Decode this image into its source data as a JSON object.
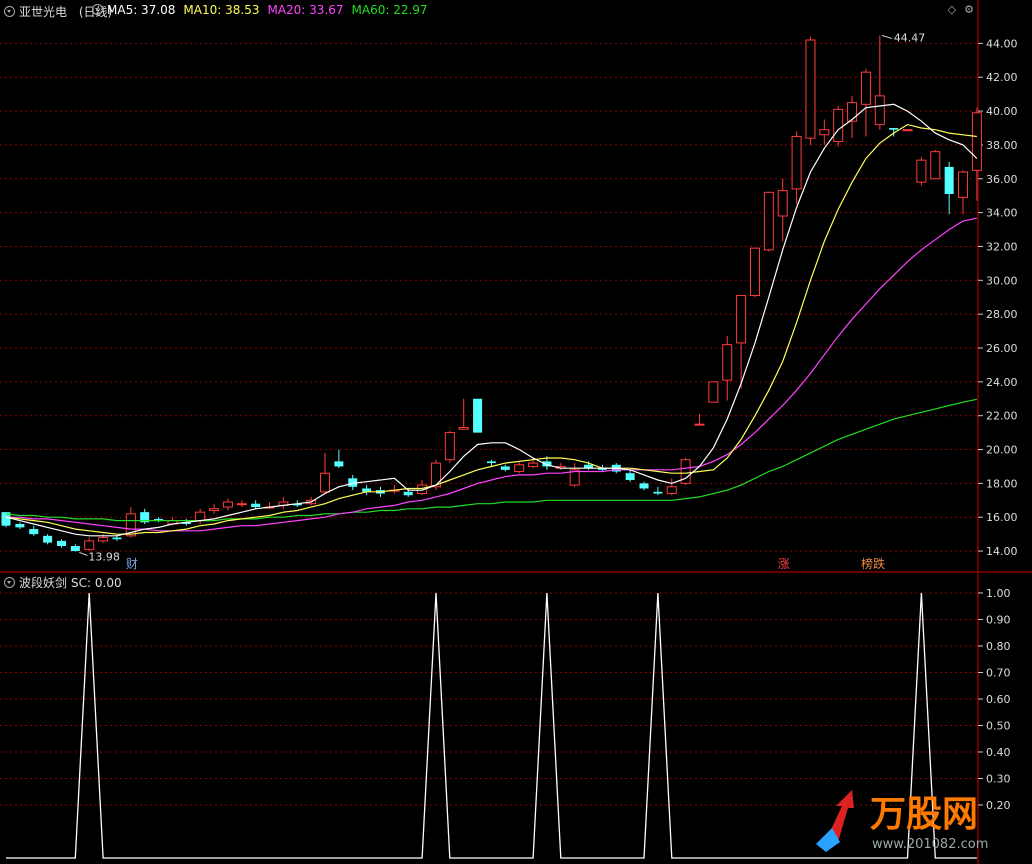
{
  "header": {
    "stock_name": "亚世光电",
    "period": "(日线)",
    "ma5": "MA5: 37.08",
    "ma10": "MA10: 38.53",
    "ma20": "MA20: 33.67",
    "ma60": "MA60: 22.97"
  },
  "indicator_header": {
    "name": "波段妖剑",
    "value": "SC: 0.00"
  },
  "top_icons": {
    "diamond": "◇",
    "settings": "⚙"
  },
  "watermark": {
    "text": "万股网",
    "url": "www.201082.com"
  },
  "colors": {
    "up": "#ff3b3b",
    "down": "#54ffff",
    "ma5": "#ffffff",
    "ma10": "#ffff55",
    "ma20": "#ff44ff",
    "ma60": "#22dd22",
    "grid": "#8a0000",
    "axis": "#ffffff"
  },
  "chart_data": [
    {
      "type": "candlestick",
      "title": "亚世光电 (日线)",
      "y_ticks": [
        14,
        16,
        18,
        20,
        22,
        24,
        26,
        28,
        30,
        32,
        34,
        36,
        38,
        40,
        42,
        44
      ],
      "y_tick_labels": [
        "14.00",
        "16.00",
        "18.00",
        "20.00",
        "22.00",
        "24.00",
        "26.00",
        "28.00",
        "30.00",
        "32.00",
        "34.00",
        "36.00",
        "38.00",
        "40.00",
        "42.00",
        "44.00"
      ],
      "ylim": [
        13.0,
        45.5
      ],
      "annotations": {
        "low": "13.98",
        "high": "44.47",
        "event1": "财",
        "event2": "涨",
        "event3": "榜跌"
      },
      "candles": [
        [
          16.3,
          15.5,
          16.3,
          15.4
        ],
        [
          15.6,
          15.4,
          15.7,
          15.3
        ],
        [
          15.3,
          15.0,
          15.5,
          14.9
        ],
        [
          14.9,
          14.5,
          15.0,
          14.4
        ],
        [
          14.6,
          14.3,
          14.7,
          14.2
        ],
        [
          14.3,
          14.0,
          14.4,
          13.98
        ],
        [
          14.1,
          14.6,
          14.8,
          14.0
        ],
        [
          14.6,
          14.8,
          15.0,
          14.5
        ],
        [
          14.8,
          14.7,
          14.9,
          14.6
        ],
        [
          14.9,
          16.2,
          16.6,
          14.8
        ],
        [
          16.3,
          15.7,
          16.5,
          15.6
        ],
        [
          15.9,
          15.8,
          16.0,
          15.7
        ],
        [
          15.6,
          15.8,
          16.0,
          15.5
        ],
        [
          15.7,
          15.6,
          15.9,
          15.5
        ],
        [
          15.8,
          16.3,
          16.5,
          15.6
        ],
        [
          16.4,
          16.5,
          16.8,
          16.2
        ],
        [
          16.6,
          16.9,
          17.1,
          16.4
        ],
        [
          16.8,
          16.8,
          17.0,
          16.6
        ],
        [
          16.8,
          16.6,
          17.0,
          16.5
        ],
        [
          16.6,
          16.6,
          16.9,
          16.5
        ],
        [
          16.7,
          16.9,
          17.2,
          16.5
        ],
        [
          16.8,
          16.7,
          17.0,
          16.6
        ],
        [
          16.8,
          17.0,
          17.2,
          16.7
        ],
        [
          17.5,
          18.6,
          19.8,
          17.4
        ],
        [
          19.3,
          19.0,
          20.0,
          18.9
        ],
        [
          18.3,
          17.8,
          18.5,
          17.6
        ],
        [
          17.7,
          17.5,
          17.9,
          17.3
        ],
        [
          17.6,
          17.4,
          17.8,
          17.2
        ],
        [
          17.6,
          17.6,
          17.9,
          17.4
        ],
        [
          17.5,
          17.3,
          17.7,
          17.2
        ],
        [
          17.4,
          17.9,
          18.2,
          17.3
        ],
        [
          17.8,
          19.2,
          19.4,
          17.6
        ],
        [
          19.4,
          21.0,
          21.1,
          19.2
        ],
        [
          21.2,
          21.3,
          23.0,
          21.2
        ],
        [
          23.0,
          21.0,
          23.0,
          21.0
        ],
        [
          19.3,
          19.2,
          19.4,
          19.0
        ],
        [
          19.0,
          18.8,
          19.1,
          18.7
        ],
        [
          18.7,
          19.1,
          19.3,
          18.6
        ],
        [
          19.0,
          19.2,
          19.5,
          18.9
        ],
        [
          19.3,
          19.0,
          19.6,
          18.8
        ],
        [
          18.9,
          19.0,
          19.2,
          18.8
        ],
        [
          17.9,
          18.8,
          19.2,
          17.8
        ],
        [
          19.1,
          18.9,
          19.3,
          18.8
        ],
        [
          18.9,
          18.8,
          19.1,
          18.7
        ],
        [
          19.1,
          18.7,
          19.2,
          18.6
        ],
        [
          18.6,
          18.2,
          18.8,
          18.1
        ],
        [
          18.0,
          17.7,
          18.1,
          17.6
        ],
        [
          17.5,
          17.4,
          17.8,
          17.3
        ],
        [
          17.4,
          17.8,
          18.3,
          17.3
        ],
        [
          18.0,
          19.4,
          19.5,
          17.9
        ],
        [
          21.5,
          21.5,
          22.1,
          21.5
        ],
        [
          22.8,
          24.0,
          24.0,
          22.8
        ],
        [
          24.1,
          26.2,
          26.7,
          22.9
        ],
        [
          26.3,
          29.1,
          29.1,
          23.6
        ],
        [
          29.1,
          31.9,
          31.9,
          29.0
        ],
        [
          31.8,
          35.2,
          35.2,
          31.7
        ],
        [
          33.8,
          35.3,
          36.0,
          32.3
        ],
        [
          35.4,
          38.5,
          38.8,
          34.5
        ],
        [
          38.4,
          44.2,
          44.4,
          38.0
        ],
        [
          38.6,
          38.9,
          39.5,
          38.0
        ],
        [
          38.2,
          40.1,
          40.3,
          37.9
        ],
        [
          39.4,
          40.5,
          40.9,
          38.4
        ],
        [
          40.4,
          42.3,
          42.5,
          38.5
        ],
        [
          39.2,
          40.9,
          44.47,
          38.9
        ],
        [
          39.0,
          38.9,
          39.0,
          38.5
        ],
        [
          38.9,
          38.9,
          38.9,
          38.9
        ],
        [
          35.8,
          37.1,
          37.3,
          35.6
        ],
        [
          36.0,
          37.6,
          37.7,
          36.0
        ],
        [
          36.7,
          35.1,
          37.0,
          33.9
        ],
        [
          34.9,
          36.4,
          36.5,
          33.9
        ],
        [
          36.5,
          39.9,
          40.2,
          34.7
        ]
      ],
      "ma5": [
        16.0,
        15.8,
        15.6,
        15.4,
        15.2,
        15.0,
        14.9,
        14.9,
        14.9,
        15.1,
        15.3,
        15.4,
        15.6,
        15.7,
        15.8,
        15.9,
        16.1,
        16.3,
        16.5,
        16.6,
        16.7,
        16.8,
        16.9,
        17.4,
        17.8,
        18.0,
        18.1,
        18.2,
        18.3,
        17.6,
        17.6,
        17.9,
        18.7,
        19.6,
        20.3,
        20.4,
        20.4,
        20.0,
        19.5,
        19.1,
        18.9,
        18.9,
        18.9,
        18.9,
        18.9,
        18.8,
        18.5,
        18.2,
        18.0,
        18.3,
        19.0,
        20.1,
        21.8,
        23.9,
        26.3,
        29.0,
        31.8,
        34.3,
        36.4,
        37.8,
        38.9,
        39.5,
        40.2,
        40.3,
        40.4,
        40.0,
        39.4,
        38.7,
        38.3,
        38.0,
        37.2
      ],
      "ma10": [
        16.0,
        15.9,
        15.8,
        15.7,
        15.5,
        15.3,
        15.2,
        15.1,
        15.0,
        15.0,
        15.1,
        15.1,
        15.2,
        15.3,
        15.5,
        15.6,
        15.8,
        15.9,
        16.0,
        16.1,
        16.3,
        16.4,
        16.6,
        16.8,
        17.1,
        17.3,
        17.5,
        17.5,
        17.6,
        17.7,
        17.7,
        17.9,
        18.2,
        18.5,
        18.8,
        19.0,
        19.2,
        19.3,
        19.4,
        19.5,
        19.5,
        19.4,
        19.2,
        18.9,
        18.9,
        18.9,
        18.8,
        18.7,
        18.6,
        18.6,
        18.7,
        18.8,
        19.5,
        20.6,
        22.0,
        23.5,
        25.2,
        27.5,
        30.0,
        32.3,
        34.2,
        35.8,
        37.2,
        38.1,
        38.7,
        39.2,
        39.0,
        38.9,
        38.7,
        38.6,
        38.5
      ],
      "ma20": [
        16.0,
        16.0,
        15.9,
        15.9,
        15.8,
        15.7,
        15.6,
        15.5,
        15.4,
        15.3,
        15.3,
        15.2,
        15.2,
        15.2,
        15.2,
        15.3,
        15.4,
        15.5,
        15.5,
        15.6,
        15.7,
        15.8,
        15.9,
        16.0,
        16.2,
        16.3,
        16.5,
        16.6,
        16.7,
        16.9,
        17.0,
        17.2,
        17.4,
        17.7,
        18.0,
        18.2,
        18.4,
        18.5,
        18.5,
        18.6,
        18.6,
        18.7,
        18.7,
        18.7,
        18.8,
        18.8,
        18.8,
        18.8,
        18.8,
        18.9,
        19.0,
        19.3,
        19.7,
        20.3,
        21.0,
        21.8,
        22.6,
        23.5,
        24.5,
        25.6,
        26.7,
        27.7,
        28.6,
        29.5,
        30.3,
        31.1,
        31.8,
        32.4,
        33.0,
        33.5,
        33.67
      ],
      "ma60": [
        16.2,
        16.1,
        16.1,
        16.0,
        16.0,
        15.9,
        15.9,
        15.9,
        15.8,
        15.8,
        15.8,
        15.8,
        15.8,
        15.8,
        15.8,
        15.8,
        15.9,
        15.9,
        15.9,
        16.0,
        16.0,
        16.1,
        16.1,
        16.2,
        16.2,
        16.3,
        16.3,
        16.4,
        16.4,
        16.5,
        16.5,
        16.6,
        16.6,
        16.7,
        16.8,
        16.8,
        16.9,
        16.9,
        16.9,
        17.0,
        17.0,
        17.0,
        17.0,
        17.0,
        17.0,
        17.0,
        17.0,
        17.0,
        17.0,
        17.1,
        17.2,
        17.4,
        17.6,
        17.9,
        18.3,
        18.7,
        19.0,
        19.4,
        19.8,
        20.2,
        20.6,
        20.9,
        21.2,
        21.5,
        21.8,
        22.0,
        22.2,
        22.4,
        22.6,
        22.8,
        22.97
      ]
    },
    {
      "type": "line",
      "title": "波段妖剑 SC",
      "y_ticks": [
        0.2,
        0.3,
        0.4,
        0.5,
        0.6,
        0.7,
        0.8,
        0.9,
        1.0
      ],
      "y_tick_labels": [
        "0.20",
        "0.30",
        "0.40",
        "0.50",
        "0.60",
        "0.70",
        "0.80",
        "0.90",
        "1.00"
      ],
      "ylim": [
        0.0,
        1.03
      ],
      "sc_peaks_at_index": [
        6,
        31,
        39,
        47,
        66
      ],
      "peak_value": 1.0
    }
  ]
}
